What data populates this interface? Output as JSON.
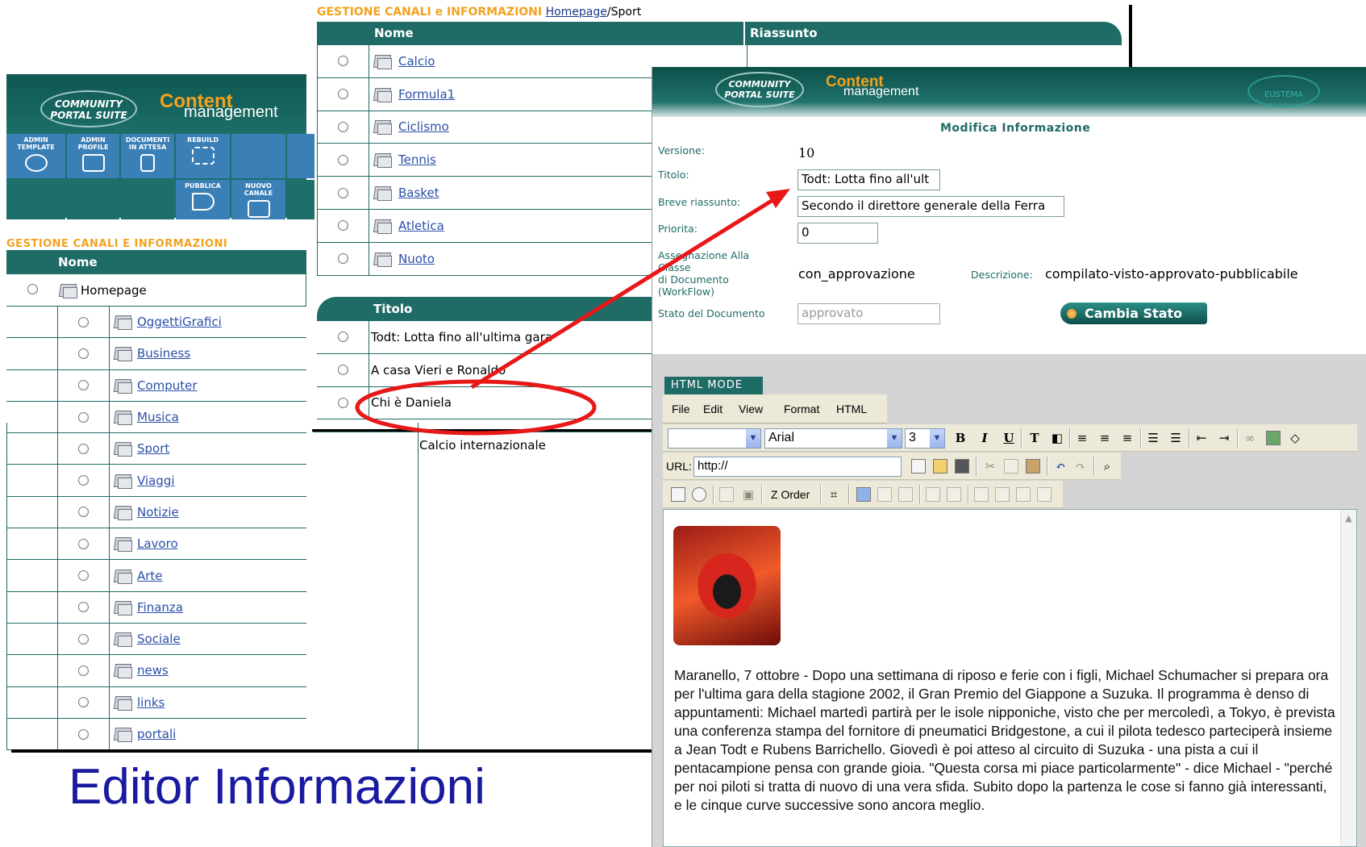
{
  "left_panel": {
    "logo_text": "COMMUNITY PORTAL SUITE",
    "brand_1": "Content",
    "brand_2": "management",
    "tools": [
      {
        "label": "ADMIN TEMPLATE",
        "icon": "gears-icon"
      },
      {
        "label": "ADMIN PROFILE",
        "icon": "folder-icon"
      },
      {
        "label": "DOCUMENTI IN ATTESA",
        "icon": "hand-icon"
      },
      {
        "label": "REBUILD",
        "icon": "bricks-icon"
      },
      {
        "label": "PUBBLICA",
        "icon": "megaphone-icon"
      },
      {
        "label": "NUOVO CANALE",
        "icon": "folder-icon"
      }
    ],
    "section_title": "GESTIONE CANALI E INFORMAZIONI",
    "column_header": "Nome",
    "root_item": "Homepage",
    "channels": [
      "OggettiGrafici",
      "Business",
      "Computer",
      "Musica",
      "Sport",
      "Viaggi",
      "Notizie",
      "Lavoro",
      "Arte",
      "Finanza",
      "Sociale",
      "news",
      "links",
      "portali"
    ],
    "extra_cell": "Calcio internazionale"
  },
  "top_panel": {
    "title": "GESTIONE CANALI e INFORMAZIONI",
    "crumb_link": "Homepage",
    "crumb_current": "/Sport",
    "col_nome": "Nome",
    "col_riassunto": "Riassunto",
    "subchannels": [
      "Calcio",
      "Formula1",
      "Ciclismo",
      "Tennis",
      "Basket",
      "Atletica",
      "Nuoto"
    ],
    "col_titolo": "Titolo",
    "articles": [
      "Todt: Lotta fino all'ultima gara",
      "A casa Vieri e Ronaldo",
      "Chi è Daniela"
    ]
  },
  "editor": {
    "logo_text": "COMMUNITY PORTAL SUITE",
    "brand_1": "Content",
    "brand_2": "management",
    "partner_logo": "EUSTEMA",
    "form_title": "Modifica Informazione",
    "versione_label": "Versione:",
    "versione_value": "10",
    "titolo_label": "Titolo:",
    "titolo_value": "Todt: Lotta fino all'ult",
    "riassunto_label": "Breve riassunto:",
    "riassunto_value": "Secondo il direttore generale della Ferra",
    "priorita_label": "Priorita:",
    "priorita_value": "0",
    "assegnazione_label_1": "Assegnazione Alla Classe",
    "assegnazione_label_2": "di Documento (WorkFlow)",
    "assegnazione_value": "con_approvazione",
    "descrizione_label": "Descrizione:",
    "descrizione_value": "compilato-visto-approvato-pubblicabile",
    "stato_label": "Stato del Documento",
    "stato_value": "approvato",
    "cambia_button": "Cambia Stato",
    "html_mode_tab": "HTML MODE",
    "menu": [
      "File",
      "Edit",
      "View",
      "Format",
      "HTML"
    ],
    "font_name": "Arial",
    "font_size": "3",
    "url_label": "URL:",
    "url_value": "http://",
    "zorder_label": "Z Order",
    "article_text": "Maranello, 7 ottobre - Dopo una settimana di riposo e ferie con i figli, Michael Schumacher si prepara ora per l'ultima gara della stagione 2002, il Gran Premio del Giappone a Suzuka. Il programma è denso di appuntamenti: Michael martedì partirà per le isole nipponiche, visto che per mercoledì, a Tokyo, è prevista una conferenza stampa del fornitore di pneumatici Bridgestone, a cui il pilota tedesco parteciperà insieme a Jean Todt e Rubens Barrichello. Giovedì è poi atteso al circuito di Suzuka - una pista a cui il pentacampione pensa con grande gioia. \"Questa corsa mi piace particolarmente\" - dice Michael - \"perché per noi piloti si tratta di nuovo di una vera sfida. Subito dopo la partenza le cose si fanno già interessanti, e le cinque curve successive sono ancora meglio."
  },
  "slide_title": "Editor Informazioni",
  "colors": {
    "header_teal": "#1f6b66",
    "accent_orange": "#f2a21e",
    "annotation_red": "#e81818",
    "title_blue": "#1a1aa0"
  }
}
